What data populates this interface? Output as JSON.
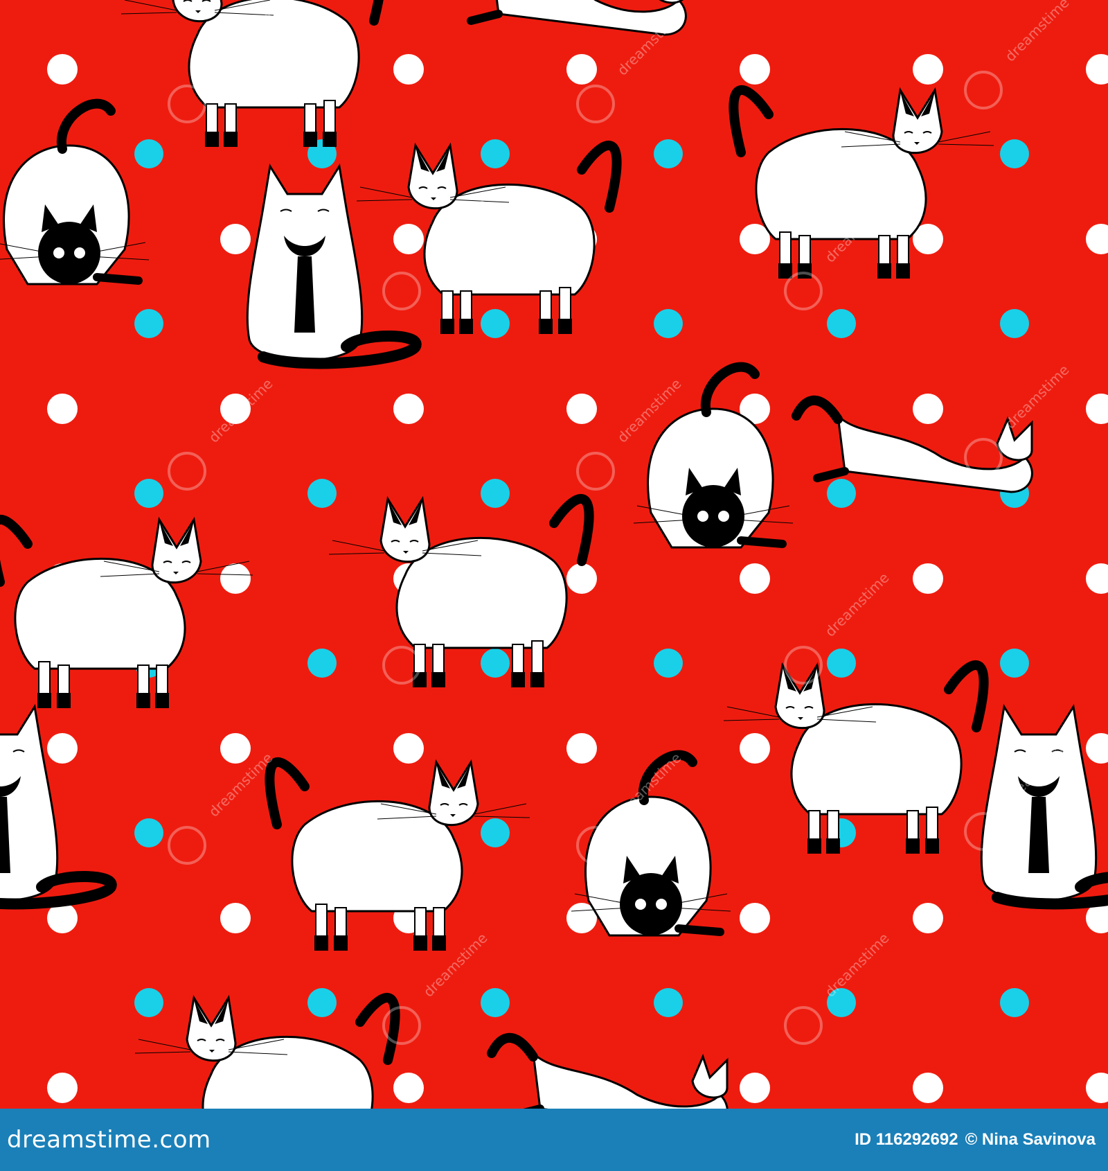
{
  "illustration": {
    "description_icon": "siamese-cat-pattern",
    "background_color": "#ee1c0f",
    "dot_colors": {
      "white": "#ffffff",
      "cyan": "#1ad0e8"
    },
    "cat_body_color": "#ffffff",
    "cat_point_color": "#000000",
    "watermark_text": "dreamstime"
  },
  "footer": {
    "site": "dreamstime.com",
    "image_id": "ID 116292692",
    "author": "© Nina Savinova",
    "background_color": "#1b80b8"
  }
}
